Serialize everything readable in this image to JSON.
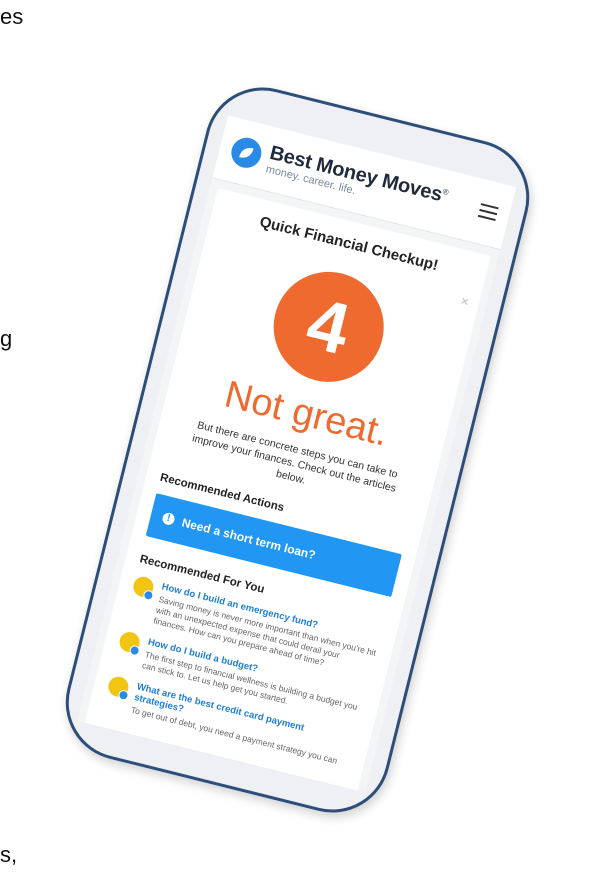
{
  "edge_fragments": [
    "es",
    "g",
    "s,"
  ],
  "header": {
    "brand_name": "Best Money Moves",
    "registered_mark": "®",
    "tagline": "money. career. life."
  },
  "checkup": {
    "title": "Quick Financial Checkup!",
    "close_label": "×",
    "score": "4",
    "verdict": "Not great.",
    "advice": "But there are concrete steps you can take to improve your finances. Check out the articles below."
  },
  "recommended_actions": {
    "title": "Recommended Actions",
    "button_label": "Need a short term loan?",
    "info_icon": "!"
  },
  "recommended_for_you": {
    "title": "Recommended For You",
    "articles": [
      {
        "title": "How do I build an emergency fund?",
        "body": "Saving money is never more important than when you're hit with an unexpected expense that could derail your finances. How can you prepare ahead of time?"
      },
      {
        "title": "How do I build a budget?",
        "body": "The first step to financial wellness is building a budget you can stick to. Let us help get you started."
      },
      {
        "title": "What are the best credit card payment strategies?",
        "body": "To get out of debt, you need a payment strategy you can"
      }
    ]
  },
  "colors": {
    "accent_blue": "#2196f3",
    "score_orange": "#ee6a2e",
    "bulb_yellow": "#f2c413",
    "phone_frame": "#2d4e7a"
  }
}
